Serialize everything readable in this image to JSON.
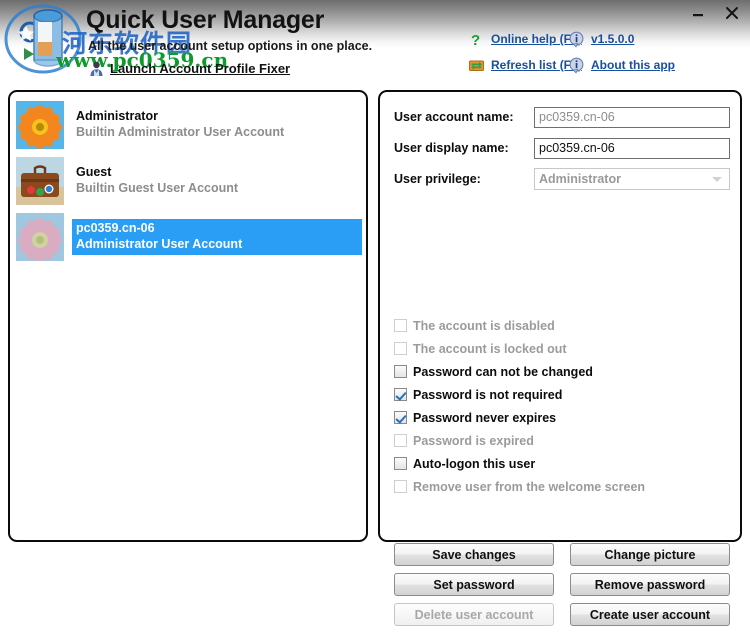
{
  "window": {
    "minimize_label": "Minimize",
    "close_label": "Close"
  },
  "header": {
    "title": "Quick User Manager",
    "subtitle": "All the user account setup options in one place.",
    "fixer_link": "Launch Account Profile Fixer",
    "watermark_cn": "河东软件园",
    "watermark_url": "www.pc0359.cn",
    "links": [
      {
        "label": "Online help (F1)",
        "icon": "question-mark-icon"
      },
      {
        "label": "v1.5.0.0",
        "icon": "info-icon"
      },
      {
        "label": "Refresh list (F5)",
        "icon": "refresh-icon"
      },
      {
        "label": "About this app",
        "icon": "info-icon"
      }
    ]
  },
  "user_list": [
    {
      "name": "Administrator",
      "description": "Builtin Administrator User Account",
      "avatar": "orange-flower-avatar",
      "selected": false
    },
    {
      "name": "Guest",
      "description": "Builtin Guest User Account",
      "avatar": "suitcase-avatar",
      "selected": false
    },
    {
      "name": "pc0359.cn-06",
      "description": "Administrator User Account",
      "avatar": "pink-flower-avatar",
      "selected": true
    }
  ],
  "form": {
    "account_name_label": "User account name:",
    "account_name_value": "pc0359.cn-06",
    "display_name_label": "User display name:",
    "display_name_value": "pc0359.cn-06",
    "privilege_label": "User privilege:",
    "privilege_value": "Administrator"
  },
  "checkboxes": [
    {
      "label": "The account is disabled",
      "checked": false,
      "enabled": false
    },
    {
      "label": "The account is locked out",
      "checked": false,
      "enabled": false
    },
    {
      "label": "Password can not be changed",
      "checked": false,
      "enabled": true
    },
    {
      "label": "Password is not required",
      "checked": true,
      "enabled": true
    },
    {
      "label": "Password never expires",
      "checked": true,
      "enabled": true
    },
    {
      "label": "Password is expired",
      "checked": false,
      "enabled": false
    },
    {
      "label": "Auto-logon this user",
      "checked": false,
      "enabled": true
    },
    {
      "label": "Remove user from the welcome screen",
      "checked": false,
      "enabled": false
    }
  ],
  "buttons": [
    {
      "label": "Save changes",
      "enabled": true
    },
    {
      "label": "Change picture",
      "enabled": true
    },
    {
      "label": "Set password",
      "enabled": true
    },
    {
      "label": "Remove password",
      "enabled": true
    },
    {
      "label": "Delete user account",
      "enabled": false
    },
    {
      "label": "Create user account",
      "enabled": true
    }
  ],
  "colors": {
    "selection": "#2a9df4",
    "link": "#1a4fa0",
    "watermark_blue": "#1f63c4",
    "watermark_green": "#0f9a2e"
  }
}
